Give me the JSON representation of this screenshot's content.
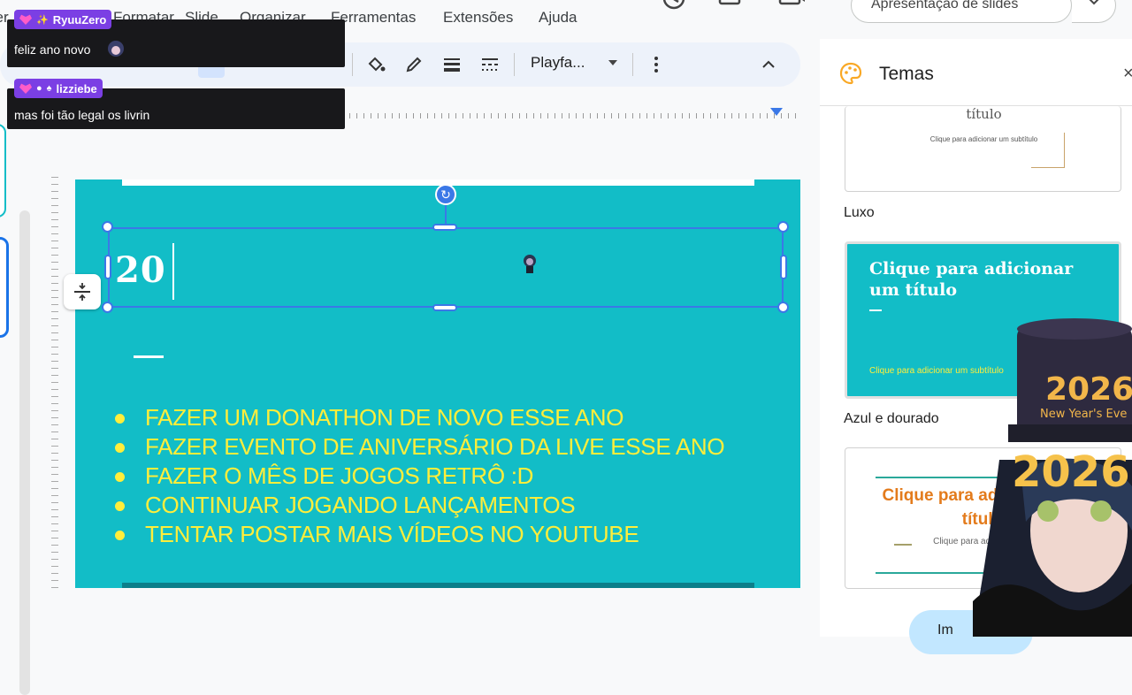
{
  "menu": {
    "items": [
      "ver",
      "Formatar",
      "Slide",
      "Organizar",
      "Ferramentas",
      "Extensões",
      "Ajuda"
    ]
  },
  "header": {
    "present_label": "Apresentação de slides"
  },
  "toolbar": {
    "font": "Playfa..."
  },
  "slide": {
    "title_text": "20",
    "bullets": [
      "FAZER UM DONATHON DE NOVO ESSE ANO",
      "FAZER EVENTO DE ANIVERSÁRIO DA LIVE ESSE ANO",
      "FAZER O MÊS DE JOGOS RETRÔ :D",
      "CONTINUAR JOGANDO LANÇAMENTOS",
      "TENTAR POSTAR MAIS VÍDEOS NO YOUTUBE"
    ],
    "bg_color": "#12bdc7",
    "text_color": "#ffee3b"
  },
  "themes": {
    "title": "Temas",
    "close": "×",
    "cards": [
      {
        "name": "Luxo",
        "title": "título",
        "subtitle": "Clique para adicionar um subtítulo"
      },
      {
        "name": "Azul e dourado",
        "title": "Clique para adicionar um título",
        "subtitle": "Clique para adicionar um subtítulo"
      },
      {
        "name": "",
        "title": "Clique para adicionar um título",
        "subtitle": "Clique para adicionar um subtítulo"
      }
    ],
    "apply_label": "Im"
  },
  "chat": [
    {
      "user": "RyuuZero",
      "text": "feliz ano novo"
    },
    {
      "user": "lizziebe",
      "text": "mas foi tão legal os livrin"
    }
  ],
  "overlay": {
    "hat_year": "2026",
    "hat_text": "New Year's Eve",
    "glasses_year": "2026"
  }
}
